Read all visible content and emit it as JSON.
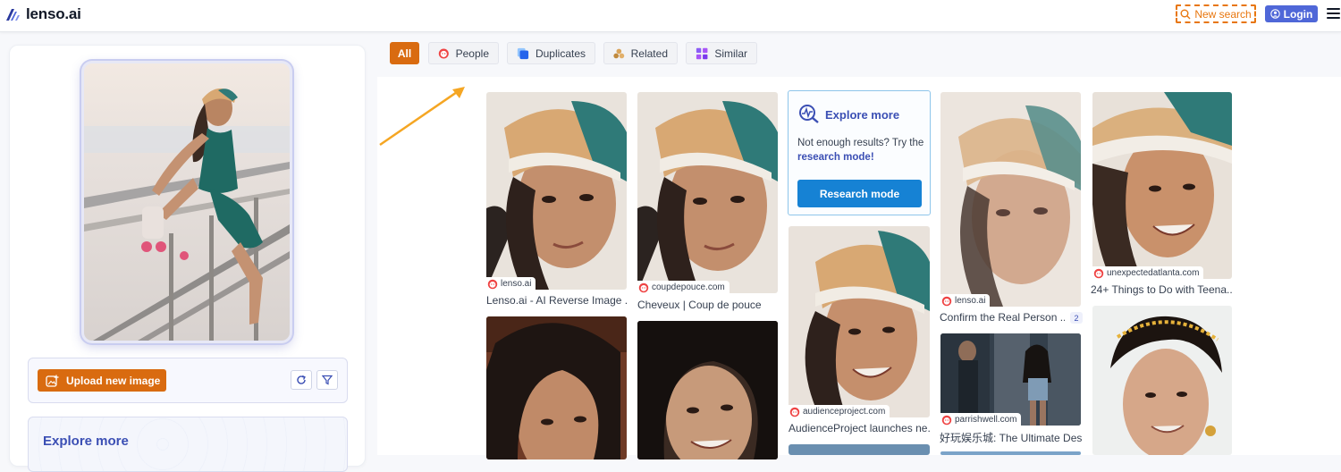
{
  "header": {
    "logo_text": "lenso.ai",
    "new_search_label": "New search",
    "login_label": "Login",
    "menu_icon": "hamburger-icon"
  },
  "sidebar": {
    "upload_label": "Upload new image",
    "refresh_icon": "refresh-icon",
    "filter_icon": "filter-icon",
    "explore_title": "Explore more"
  },
  "tabs": [
    {
      "label": "All",
      "icon": "",
      "active": true
    },
    {
      "label": "People",
      "icon": "face-icon",
      "active": false
    },
    {
      "label": "Duplicates",
      "icon": "duplicates-icon",
      "active": false
    },
    {
      "label": "Related",
      "icon": "related-icon",
      "active": false
    },
    {
      "label": "Similar",
      "icon": "grid-icon",
      "active": false
    }
  ],
  "results": [
    {
      "source": "lenso.ai",
      "title": "Lenso.ai - AI Reverse Image ..."
    },
    {
      "source": "coupdepouce.com",
      "title": "Cheveux | Coup de pouce"
    },
    {
      "source": "audienceproject.com",
      "title": "AudienceProject launches ne..."
    },
    {
      "source": "lenso.ai",
      "title": "Confirm the Real Person ...",
      "count": "2"
    },
    {
      "source": "parrishwell.com",
      "title": "好玩娱乐城: The Ultimate Des..."
    },
    {
      "source": "unexpectedatlanta.com",
      "title": "24+ Things to Do with Teena..."
    }
  ],
  "explore_card": {
    "title": "Explore more",
    "text_before": "Not enough results? Try the ",
    "text_link": "research mode!",
    "button_label": "Research mode"
  },
  "colors": {
    "accent_orange": "#d96b10",
    "brand_blue": "#3b4fb4",
    "research_blue": "#1682d4",
    "arrow": "#f5a623"
  }
}
